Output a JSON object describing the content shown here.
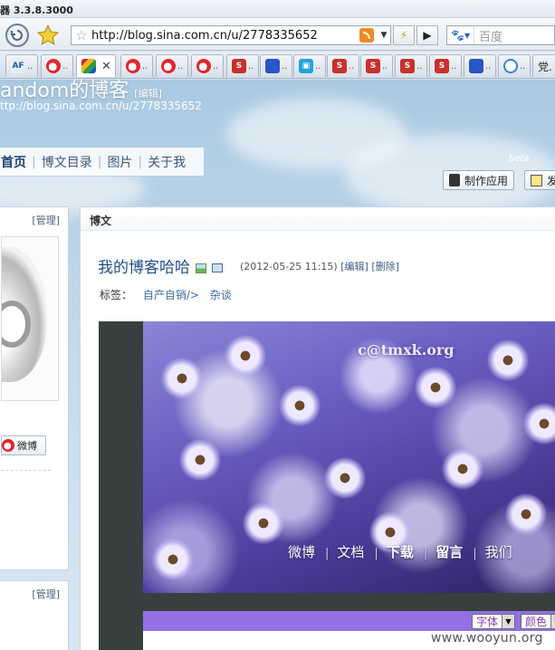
{
  "browser": {
    "title_text": "器 3.3.8.3000",
    "url": "http://blog.sina.com.cn/u/2778335652",
    "search_placeholder": "百度",
    "tabs": [
      {
        "icon": "af-icon"
      },
      {
        "icon": "weibo-icon"
      },
      {
        "icon": "colorful-icon",
        "active": true
      },
      {
        "icon": "weibo-icon"
      },
      {
        "icon": "weibo-icon"
      },
      {
        "icon": "weibo-icon"
      },
      {
        "icon": "sina-icon"
      },
      {
        "icon": "baidu-paw-icon"
      },
      {
        "icon": "cyan-icon"
      },
      {
        "icon": "sina-icon"
      },
      {
        "icon": "sina-icon"
      },
      {
        "icon": "sina-icon"
      },
      {
        "icon": "sina-icon"
      },
      {
        "icon": "baidu-paw-icon"
      },
      {
        "icon": "g-icon"
      }
    ],
    "last_tab_label": "党.",
    "tab_dots": ".."
  },
  "blog": {
    "title": "andom的博客",
    "title_edit": "[编辑]",
    "url": "ttp://blog.sina.com.cn/u/2778335652",
    "nav": [
      "首页",
      "博文目录",
      "图片",
      "关于我"
    ],
    "beta": "beta",
    "make_app": "制作应用",
    "publish": "发"
  },
  "left": {
    "manage": "[管理]",
    "weibo": "微博",
    "manage2": "[管理]"
  },
  "main": {
    "header": "博文",
    "post_title": "我的博客哈哈",
    "post_date": "(2012-05-25 11:15)",
    "edit": "[编辑]",
    "delete": "[删除]",
    "tags_label": "标签：",
    "tags": [
      "自产自销/>",
      "杂谈"
    ],
    "image_watermark": "c@tmxk.org",
    "image_menu": [
      "微博",
      "文档",
      "下载",
      "留言",
      "我们"
    ],
    "font_select": "字体",
    "color_select": "颜色"
  },
  "footer_watermark": "www.wooyun.org",
  "colors": {
    "purple_bar": "#9470e6",
    "link": "#1f4f86"
  }
}
